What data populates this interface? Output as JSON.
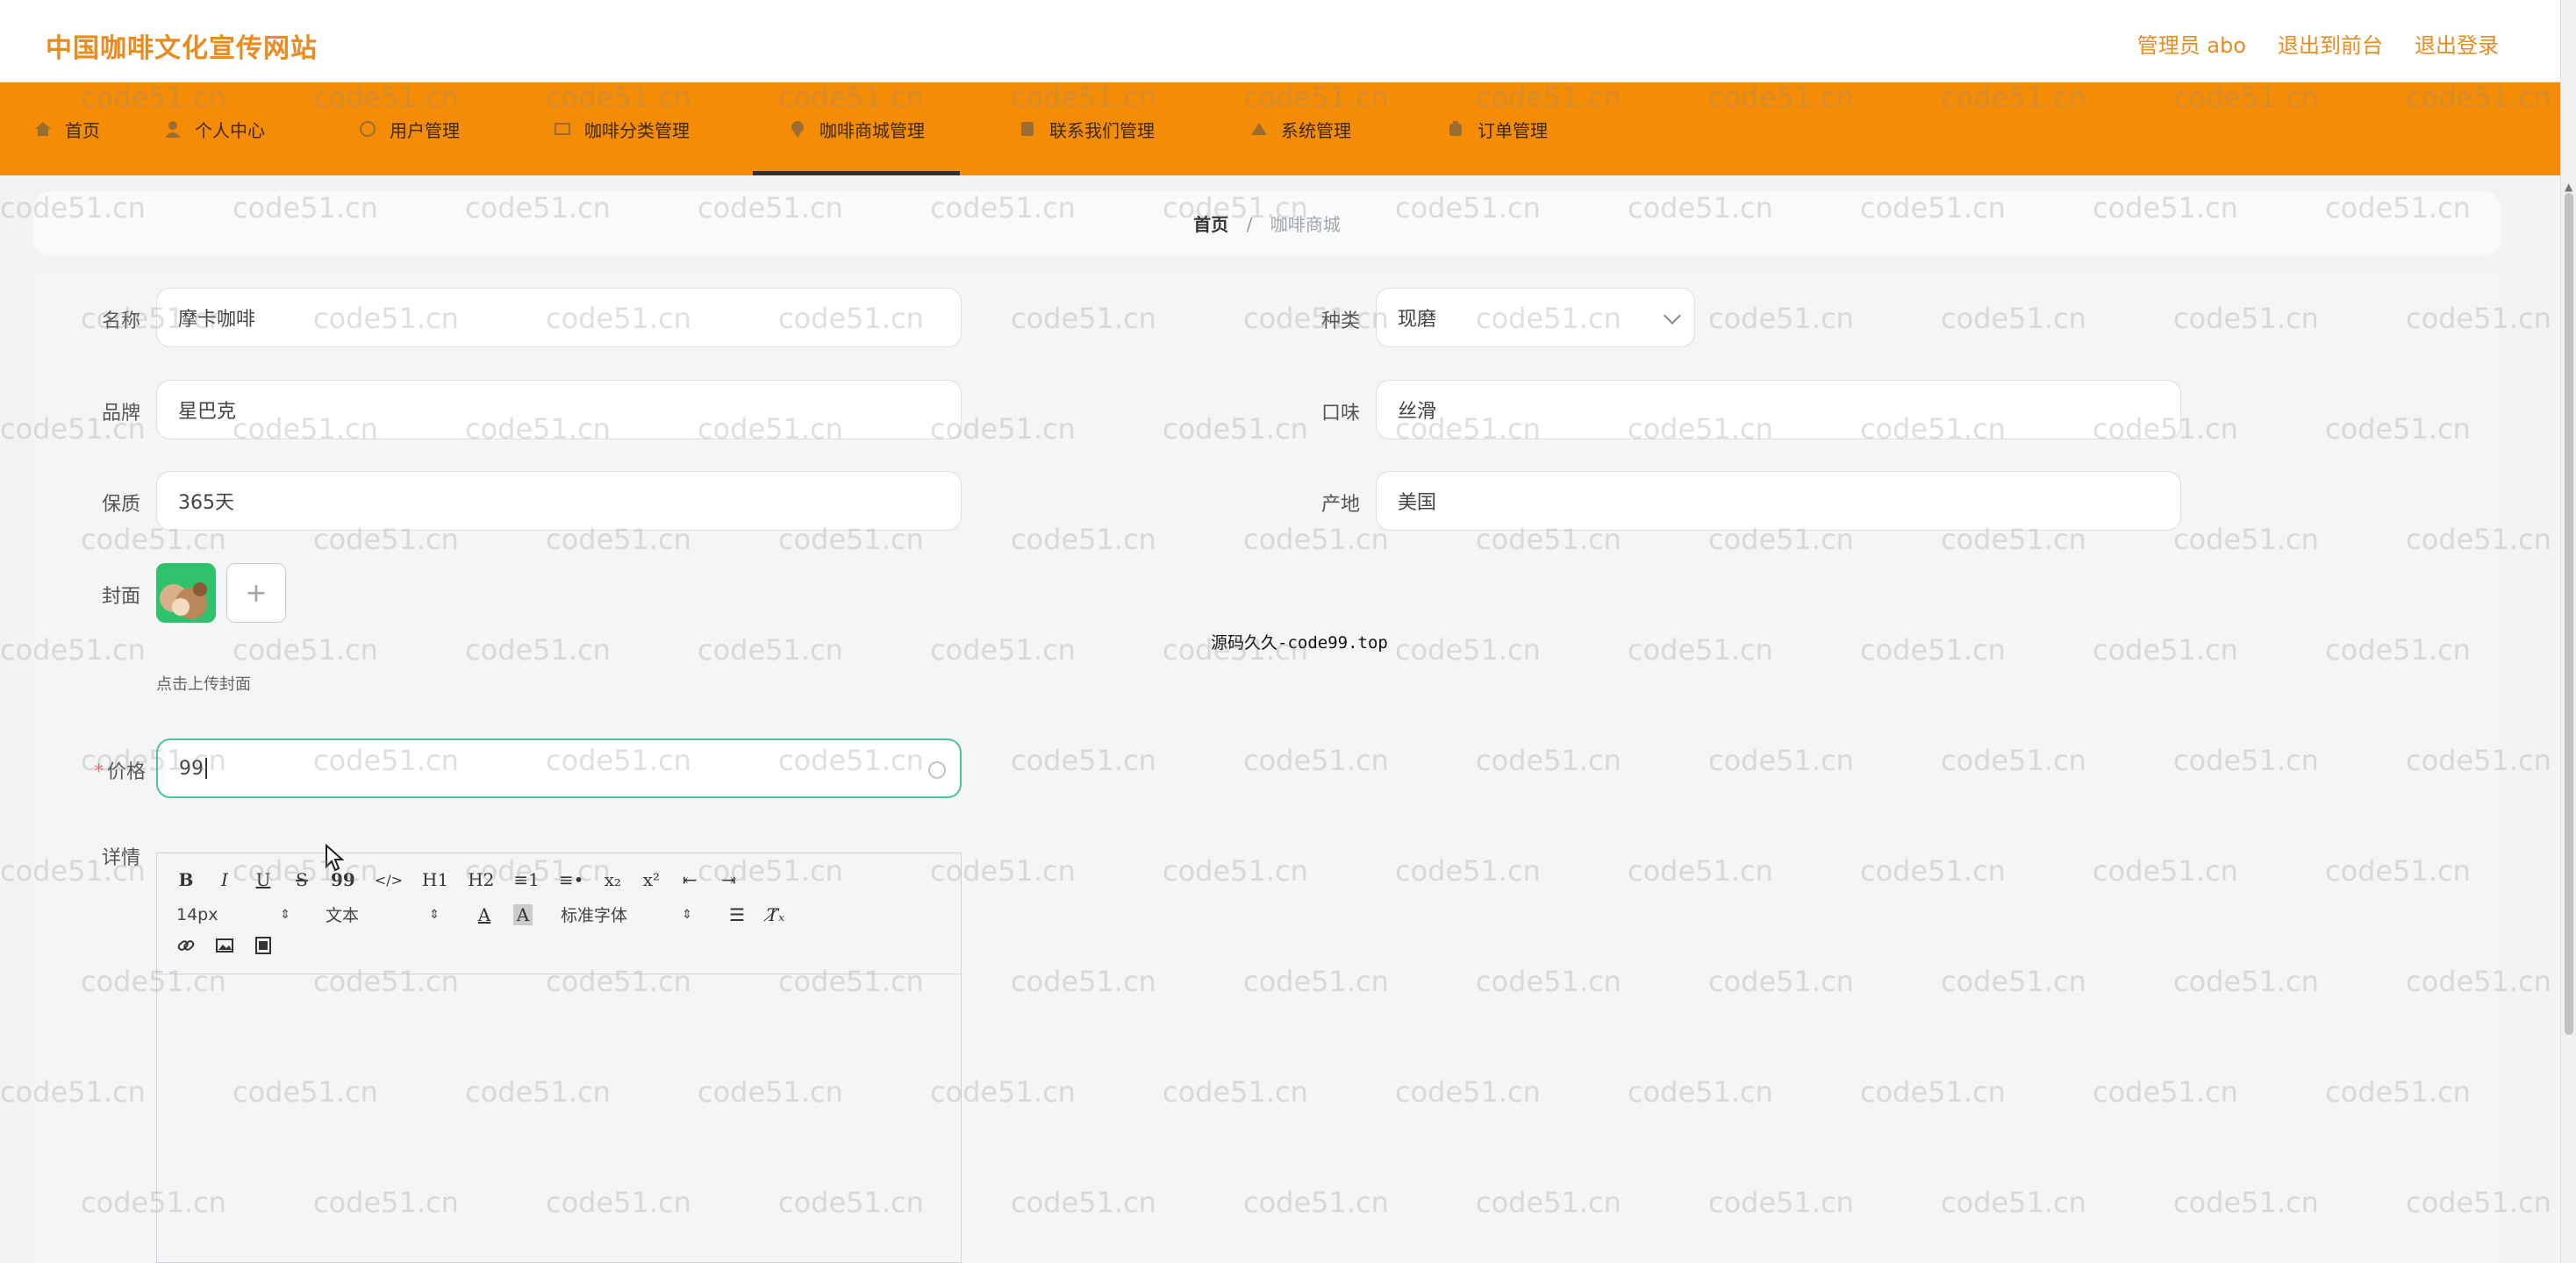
{
  "header": {
    "site_title": "中国咖啡文化宣传网站",
    "user_label": "管理员 abo",
    "to_front": "退出到前台",
    "logout": "退出登录"
  },
  "nav": {
    "items": [
      {
        "label": "首页"
      },
      {
        "label": "个人中心"
      },
      {
        "label": "用户管理"
      },
      {
        "label": "咖啡分类管理"
      },
      {
        "label": "咖啡商城管理"
      },
      {
        "label": "联系我们管理"
      },
      {
        "label": "系统管理"
      },
      {
        "label": "订单管理"
      }
    ],
    "active_index": 4
  },
  "breadcrumb": {
    "home": "首页",
    "separator": "/",
    "current": "咖啡商城"
  },
  "form": {
    "name": {
      "label": "名称",
      "value": "摩卡咖啡"
    },
    "category": {
      "label": "种类",
      "value": "现磨"
    },
    "brand": {
      "label": "品牌",
      "value": "星巴克"
    },
    "flavor": {
      "label": "口味",
      "value": "丝滑"
    },
    "shelf_life": {
      "label": "保质",
      "value": "365天"
    },
    "origin": {
      "label": "产地",
      "value": "美国"
    },
    "cover": {
      "label": "封面",
      "add_symbol": "+",
      "hint": "点击上传封面"
    },
    "price": {
      "label": "价格",
      "value": "99"
    },
    "detail": {
      "label": "详情"
    }
  },
  "center_note": "源码久久-code99.top",
  "editor": {
    "row1": [
      "B",
      "I",
      "U",
      "S",
      "99",
      "</>",
      "H1",
      "H2",
      "≡1",
      "≡•",
      "x₂",
      "x²",
      "⇤",
      "⇥"
    ],
    "font_size": "14px",
    "block_type": "文本",
    "font_family": "标准字体",
    "row3_icons": [
      "link-icon",
      "image-icon",
      "video-icon"
    ]
  },
  "watermark": "code51.cn",
  "colors": {
    "brand_orange": "#f48c06",
    "title_orange": "#e98b1f",
    "focus_green": "#4cc39a"
  }
}
